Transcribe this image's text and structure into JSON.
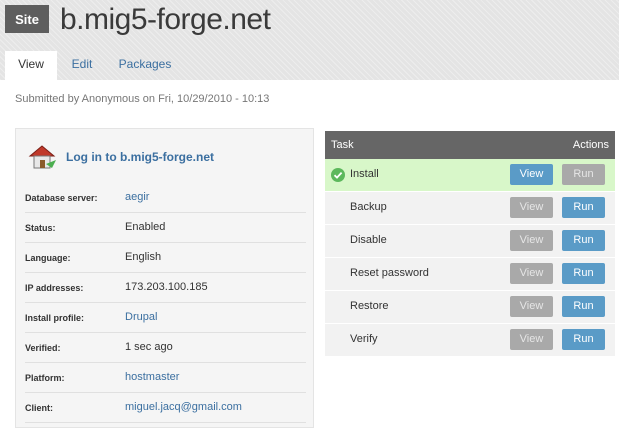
{
  "header": {
    "badge": "Site",
    "title": "b.mig5-forge.net",
    "tabs": [
      {
        "label": "View"
      },
      {
        "label": "Edit"
      },
      {
        "label": "Packages"
      }
    ]
  },
  "submitted": "Submitted by Anonymous on Fri, 10/29/2010 - 10:13",
  "info": {
    "login_link": "Log in to b.mig5-forge.net",
    "rows": [
      {
        "label": "Database server:",
        "value": "aegir"
      },
      {
        "label": "Status:",
        "value": "Enabled"
      },
      {
        "label": "Language:",
        "value": "English"
      },
      {
        "label": "IP addresses:",
        "value": "173.203.100.185"
      },
      {
        "label": "Install profile:",
        "value": "Drupal"
      },
      {
        "label": "Verified:",
        "value": "1 sec ago"
      },
      {
        "label": "Platform:",
        "value": "hostmaster"
      },
      {
        "label": "Client:",
        "value": "miguel.jacq@gmail.com"
      }
    ]
  },
  "tasks": {
    "col_task": "Task",
    "col_actions": "Actions",
    "view_label": "View",
    "run_label": "Run",
    "rows": [
      {
        "name": "Install"
      },
      {
        "name": "Backup"
      },
      {
        "name": "Disable"
      },
      {
        "name": "Reset password"
      },
      {
        "name": "Restore"
      },
      {
        "name": "Verify"
      }
    ]
  },
  "colors": {
    "link": "#3b6fa0",
    "button_active": "#5a9bc7",
    "button_disabled": "#a9a9a9",
    "done_row": "#d8f7c9",
    "table_header": "#666666"
  }
}
